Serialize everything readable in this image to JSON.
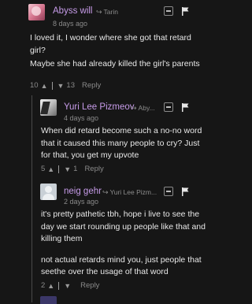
{
  "comments": [
    {
      "author": "Abyss will",
      "reply_to": "Tarin",
      "time": "8 days ago",
      "paragraphs": [
        "I loved it, I wonder where she got that retard girl?",
        "Maybe she had already killed the girl's parents"
      ],
      "upvotes": "10",
      "downvotes": "13",
      "reply_label": "Reply"
    },
    {
      "author": "Yuri Lee Pizmeov",
      "reply_to": "Aby...",
      "time": "4 days ago",
      "paragraphs": [
        "When did retard become such a no-no word that it caused this many people to cry? Just for that, you get my upvote"
      ],
      "upvotes": "5",
      "downvotes": "1",
      "reply_label": "Reply"
    },
    {
      "author": "neig gehr",
      "reply_to": "Yuri Lee Pizm...",
      "time": "2 days ago",
      "paragraphs": [
        "it's pretty pathetic tbh, hope i live to see the day we start rounding up people like that and killing them",
        "not actual retards mind you, just people that seethe over the usage of that word"
      ],
      "upvotes": "2",
      "downvotes": "",
      "reply_label": "Reply"
    }
  ],
  "icons": {
    "upvote": "▲",
    "downvote": "▼",
    "reply_arrow": "↪",
    "collapse": "minus-box-icon",
    "flag": "flag-icon"
  },
  "colors": {
    "background": "#161616",
    "author": "#c69be8",
    "meta": "#8a8a8a"
  }
}
